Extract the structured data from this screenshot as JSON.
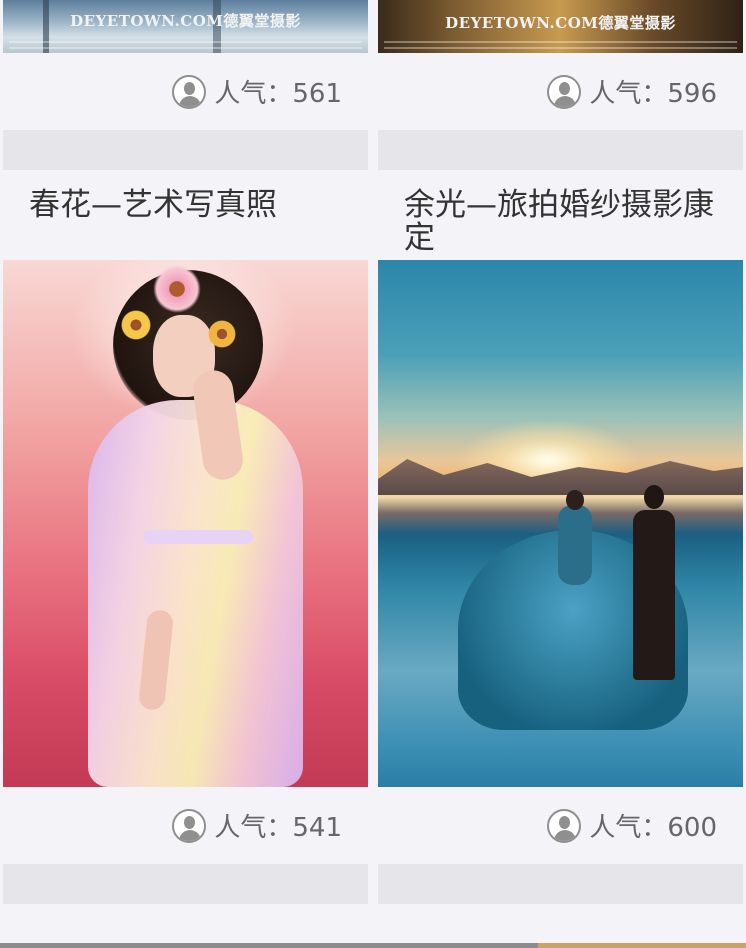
{
  "popularity_label": "人气：",
  "items": [
    {
      "title": "",
      "watermark": "DEYETOWN.COM德翼堂摄影",
      "popularity": "561"
    },
    {
      "title": "",
      "watermark": "DEYETOWN.COM德翼堂摄影",
      "popularity": "596"
    },
    {
      "title": "春花—艺术写真照",
      "watermark": "",
      "popularity": "541"
    },
    {
      "title": "余光—旅拍婚纱摄影康定",
      "watermark": "",
      "popularity": "600"
    }
  ],
  "colors": {
    "background": "#f3f3f8",
    "text": "#333333",
    "muted_text": "#666666",
    "placeholder_bar": "#e6e6ea",
    "accent": "#c9a46a"
  },
  "icons": {
    "popularity": "user-avatar-icon"
  }
}
